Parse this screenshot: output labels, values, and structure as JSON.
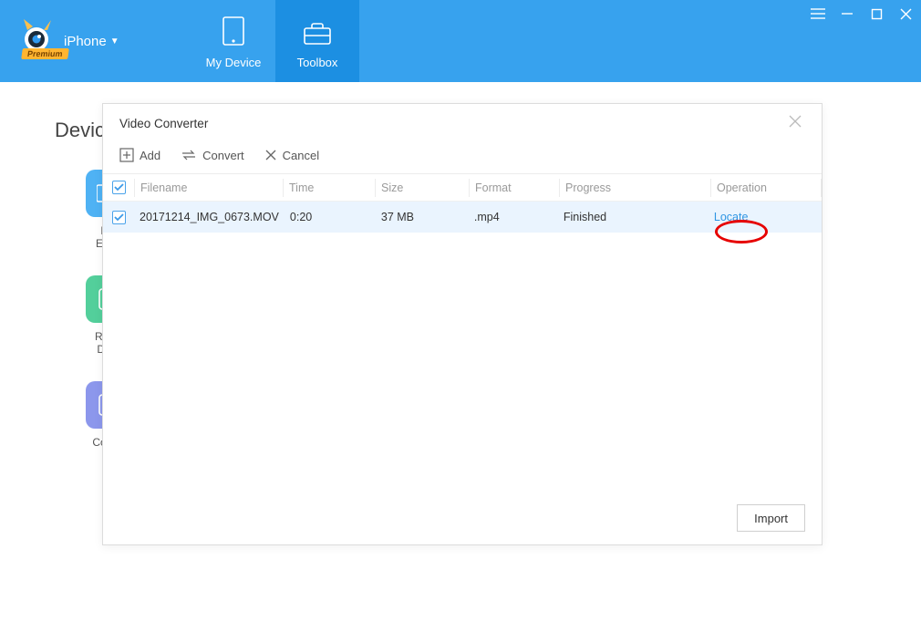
{
  "brand": {
    "device_label": "iPhone",
    "premium": "Premium"
  },
  "header_tabs": {
    "my_device": "My Device",
    "toolbox": "Toolbox"
  },
  "page": {
    "title_partial": "Devic",
    "tool_file_explorer_l1": "File",
    "tool_file_explorer_l2": "Explo",
    "tool_realtime_l1": "Real-t",
    "tool_realtime_l2": "Desk",
    "tool_console": "Consol"
  },
  "dialog": {
    "title": "Video Converter",
    "toolbar": {
      "add": "Add",
      "convert": "Convert",
      "cancel": "Cancel"
    },
    "columns": {
      "filename": "Filename",
      "time": "Time",
      "size": "Size",
      "format": "Format",
      "progress": "Progress",
      "operation": "Operation"
    },
    "rows": [
      {
        "checked": true,
        "filename": "20171214_IMG_0673.MOV",
        "time": "0:20",
        "size": "37 MB",
        "format": ".mp4",
        "progress": "Finished",
        "operation": "Locate"
      }
    ],
    "footer": {
      "import": "Import"
    }
  }
}
